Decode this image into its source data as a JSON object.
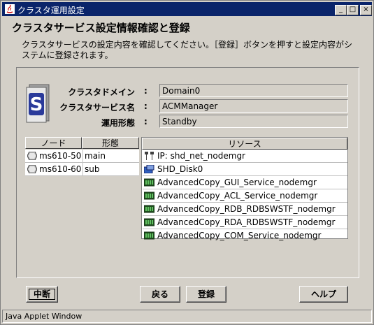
{
  "window": {
    "title": "クラスタ運用設定",
    "controls": {
      "minimize": "_",
      "maximize": "□",
      "close": "×"
    }
  },
  "heading": "クラスタサービス設定情報確認と登録",
  "description": "クラスタサービスの設定内容を確認してください。［登録］ボタンを押すと設定内容がシステムに登録されます。",
  "info": {
    "domain_label": "クラスタドメイン",
    "domain_value": "Domain0",
    "service_label": "クラスタサービス名",
    "service_value": "ACMManager",
    "mode_label": "運用形態",
    "mode_value": "Standby",
    "colon": ":"
  },
  "node_table": {
    "headers": [
      "ノード",
      "形態"
    ],
    "rows": [
      {
        "node": "ms610-50",
        "form": "main"
      },
      {
        "node": "ms610-60",
        "form": "sub"
      }
    ]
  },
  "resource_table": {
    "header": "リソース",
    "rows": [
      {
        "icon": "network-icon",
        "label": "IP: shd_net_nodemgr"
      },
      {
        "icon": "disk-icon",
        "label": "SHD_Disk0"
      },
      {
        "icon": "service-icon",
        "label": "AdvancedCopy_GUI_Service_nodemgr"
      },
      {
        "icon": "service-icon",
        "label": "AdvancedCopy_ACL_Service_nodemgr"
      },
      {
        "icon": "service-icon",
        "label": "AdvancedCopy_RDB_RDBSWSTF_nodemgr"
      },
      {
        "icon": "service-icon",
        "label": "AdvancedCopy_RDA_RDBSWSTF_nodemgr"
      },
      {
        "icon": "service-icon",
        "label": "AdvancedCopy_COM_Service_nodemgr"
      }
    ]
  },
  "buttons": {
    "abort": "中断",
    "back": "戻る",
    "register": "登録",
    "help": "ヘルプ"
  },
  "status_bar": "Java Applet Window"
}
